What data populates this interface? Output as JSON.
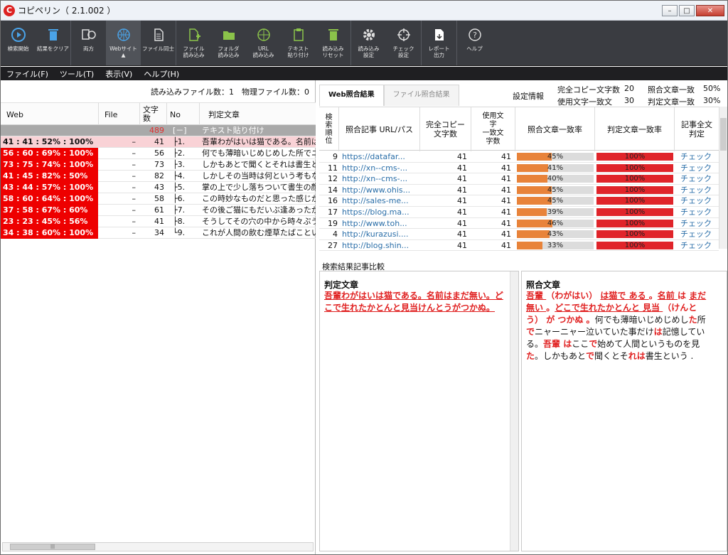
{
  "app": {
    "title": "コピペリン（ 2.1.002 ）"
  },
  "toolbar": {
    "buttons": [
      {
        "label": "検索開始",
        "icon": "play-icon"
      },
      {
        "label": "結果をクリア",
        "icon": "trash-icon"
      },
      {
        "label": "両方",
        "icon": "file-web-icon"
      },
      {
        "label": "Webサイト\n▲",
        "icon": "globe-icon"
      },
      {
        "label": "ファイル同士",
        "icon": "file-icon"
      },
      {
        "label": "ファイル\n読み込み",
        "icon": "file-add-icon"
      },
      {
        "label": "フォルダ\n読み込み",
        "icon": "folder-add-icon"
      },
      {
        "label": "URL\n読み込み",
        "icon": "globe-add-icon"
      },
      {
        "label": "テキスト\n貼り付け",
        "icon": "clipboard-icon"
      },
      {
        "label": "読み込み\nリセット",
        "icon": "trash-green-icon"
      },
      {
        "label": "読み込み\n設定",
        "icon": "gear-icon"
      },
      {
        "label": "チェック\n設定",
        "icon": "crosshair-icon"
      },
      {
        "label": "レポート\n出力",
        "icon": "export-icon"
      },
      {
        "label": "ヘルプ",
        "icon": "help-icon"
      }
    ]
  },
  "menu": {
    "items": [
      "ファイル(F)",
      "ツール(T)",
      "表示(V)",
      "ヘルプ(H)"
    ]
  },
  "left": {
    "file_info": "読み込みファイル数：1　物理ファイル数：0",
    "headers": {
      "web": "Web",
      "file": "File",
      "count": "文字\n数",
      "no": "No",
      "text": "判定文章"
    },
    "rows": [
      {
        "web": "",
        "file": "",
        "count": "489",
        "no": "[－]",
        "text": "テキスト貼り付け",
        "style": "gray"
      },
      {
        "web": "41 : 41 : 52% : 100%",
        "file": "–",
        "count": "41",
        "no": "├1.",
        "text": "吾輩わがはいは猫である。名前はまだ",
        "style": "pink"
      },
      {
        "web": "56 : 60 : 69% : 100%",
        "file": "–",
        "count": "56",
        "no": "├2.",
        "text": "何でも薄暗いじめじめした所でニャー",
        "style": "red"
      },
      {
        "web": "73 : 75 : 74% : 100%",
        "file": "–",
        "count": "73",
        "no": "├3.",
        "text": "しかもあとで聞くとそれは書生という人",
        "style": "red"
      },
      {
        "web": "41 : 45 : 82% : 50%",
        "file": "–",
        "count": "82",
        "no": "├4.",
        "text": "しかしその当時は何という考もなかった",
        "style": "red"
      },
      {
        "web": "43 : 44 : 57% : 100%",
        "file": "–",
        "count": "43",
        "no": "├5.",
        "text": "掌の上で少し落ちついて書生の顔を見",
        "style": "red"
      },
      {
        "web": "58 : 60 : 64% : 100%",
        "file": "–",
        "count": "58",
        "no": "├6.",
        "text": "この時妙なものだと思った感じが今でも",
        "style": "red"
      },
      {
        "web": "37 : 58 : 67% : 60%",
        "file": "–",
        "count": "61",
        "no": "├7.",
        "text": "その後ご猫にもだいぶ逢あったがこんな",
        "style": "red"
      },
      {
        "web": "23 : 23 : 45% : 56%",
        "file": "–",
        "count": "41",
        "no": "├8.",
        "text": "そうしてその穴の中から時々ぷうぷうと",
        "style": "red"
      },
      {
        "web": "34 : 38 : 60% : 100%",
        "file": "–",
        "count": "34",
        "no": "└9.",
        "text": "これが人間の飲む煙草たばこというもの",
        "style": "red"
      }
    ]
  },
  "right": {
    "tabs": [
      "Web照合結果",
      "ファイル照合結果"
    ],
    "settings": {
      "title": "設定情報",
      "full_copy_label": "完全コピー文字数",
      "full_copy_value": "20",
      "used_label": "使用文字一致文",
      "used_value": "30",
      "match_label": "照合文章一致",
      "match_value": "50%",
      "judge_label": "判定文章一致",
      "judge_value": "30%"
    },
    "headers": {
      "rank": "検\n索\n順\n位",
      "url": "照合記事 URL/パス",
      "full": "完全コピー\n文字数",
      "used": "使用文\n字\n一致文\n字数",
      "match": "照合文章一致率",
      "judge": "判定文章一致率",
      "check": "記事全文\n判定"
    },
    "rows": [
      {
        "rank": "9",
        "url": "https://datafar...",
        "full": "41",
        "used": "41",
        "match": 45,
        "judge": 100,
        "check": "チェック"
      },
      {
        "rank": "11",
        "url": "http://xn--cms-...",
        "full": "41",
        "used": "41",
        "match": 41,
        "judge": 100,
        "check": "チェック"
      },
      {
        "rank": "12",
        "url": "http://xn--cms-...",
        "full": "41",
        "used": "41",
        "match": 40,
        "judge": 100,
        "check": "チェック"
      },
      {
        "rank": "14",
        "url": "http://www.ohis...",
        "full": "41",
        "used": "41",
        "match": 45,
        "judge": 100,
        "check": "チェック"
      },
      {
        "rank": "16",
        "url": "http://sales-me...",
        "full": "41",
        "used": "41",
        "match": 45,
        "judge": 100,
        "check": "チェック"
      },
      {
        "rank": "17",
        "url": "https://blog.ma...",
        "full": "41",
        "used": "41",
        "match": 39,
        "judge": 100,
        "check": "チェック"
      },
      {
        "rank": "19",
        "url": "http://www.toh...",
        "full": "41",
        "used": "41",
        "match": 46,
        "judge": 100,
        "check": "チェック"
      },
      {
        "rank": "4",
        "url": "http://kurazusi....",
        "full": "41",
        "used": "41",
        "match": 43,
        "judge": 100,
        "check": "チェック"
      },
      {
        "rank": "27",
        "url": "http://blog.shin...",
        "full": "41",
        "used": "41",
        "match": 33,
        "judge": 100,
        "check": "チェック"
      }
    ],
    "compare_label": "検索結果記事比較",
    "judge_title": "判定文章",
    "judge_text": "吾輩わがはいは猫である。名前はまだ無い。どこで生れたかとんと見当けんとうがつかぬ。",
    "match_title": "照合文章",
    "match_segments": [
      {
        "t": "吾輩 ",
        "s": "hlu"
      },
      {
        "t": "（わがはい） ",
        "s": "hl"
      },
      {
        "t": "は猫で ",
        "s": "hlu"
      },
      {
        "t": "ある ",
        "s": "hlu"
      },
      {
        "t": "。",
        "s": "hl"
      },
      {
        "t": "名前 ",
        "s": "hlu"
      },
      {
        "t": "は ",
        "s": "hl"
      },
      {
        "t": "まだ",
        "s": "hlu"
      },
      {
        "t": "無い ",
        "s": "hlu"
      },
      {
        "t": "。",
        "s": "hl"
      },
      {
        "t": "どこで生れたかとんと ",
        "s": "hlu"
      },
      {
        "t": "見当 ",
        "s": "hlu"
      },
      {
        "t": "（けんとう） ",
        "s": "hl"
      },
      {
        "t": "が つかぬ ",
        "s": "hl"
      },
      {
        "t": "。",
        "s": "hl"
      },
      {
        "t": "何でも薄暗いじめじめし",
        "s": ""
      },
      {
        "t": "た",
        "s": "hl"
      },
      {
        "t": "所",
        "s": ""
      },
      {
        "t": "で",
        "s": "hl"
      },
      {
        "t": "ニャーニャー泣いていた事だけ",
        "s": ""
      },
      {
        "t": "は",
        "s": "hl"
      },
      {
        "t": "記憶している。",
        "s": ""
      },
      {
        "t": "吾輩 ",
        "s": "hl"
      },
      {
        "t": "は",
        "s": "hl"
      },
      {
        "t": "ここ",
        "s": ""
      },
      {
        "t": "で",
        "s": "hl"
      },
      {
        "t": "始めて人間というものを見",
        "s": ""
      },
      {
        "t": "た",
        "s": "hl"
      },
      {
        "t": "。しかもあと",
        "s": ""
      },
      {
        "t": "で",
        "s": "hl"
      },
      {
        "t": "聞くとそ",
        "s": ""
      },
      {
        "t": "れ",
        "s": "hl"
      },
      {
        "t": "は",
        "s": "hl"
      },
      {
        "t": "書生という .",
        "s": ""
      }
    ]
  }
}
